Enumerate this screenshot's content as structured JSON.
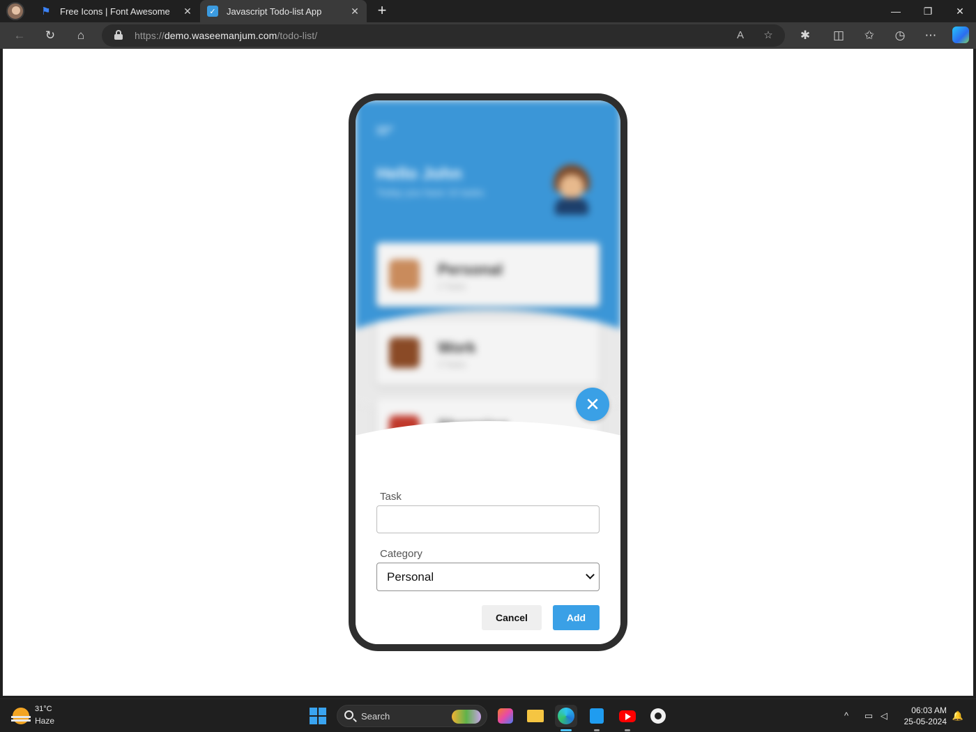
{
  "browser": {
    "tabs": [
      {
        "title": "Free Icons | Font Awesome",
        "favicon": "font-awesome-flag-icon"
      },
      {
        "title": "Javascript Todo-list App",
        "favicon": "todo-check-icon"
      }
    ],
    "url": {
      "scheme": "https://",
      "host": "demo.waseemanjum.com",
      "path": "/todo-list/"
    }
  },
  "app": {
    "greeting": "Hello John",
    "subtitle": "Today you have 10 tasks",
    "categories": [
      {
        "name": "Personal",
        "count": "2 Tasks",
        "icon": "person-icon"
      },
      {
        "name": "Work",
        "count": "3 Tasks",
        "icon": "briefcase-icon"
      },
      {
        "name": "Shopping",
        "icon": "shopping-bag-icon"
      }
    ],
    "form": {
      "task_label": "Task",
      "task_value": "",
      "category_label": "Category",
      "category_value": "Personal",
      "cancel_label": "Cancel",
      "add_label": "Add"
    },
    "accent_color": "#3aa0e6",
    "hero_color": "#3b96d7"
  },
  "taskbar": {
    "weather": {
      "temp": "31°C",
      "condition": "Haze"
    },
    "search_placeholder": "Search",
    "clock": {
      "time": "06:03 AM",
      "date": "25-05-2024"
    }
  }
}
